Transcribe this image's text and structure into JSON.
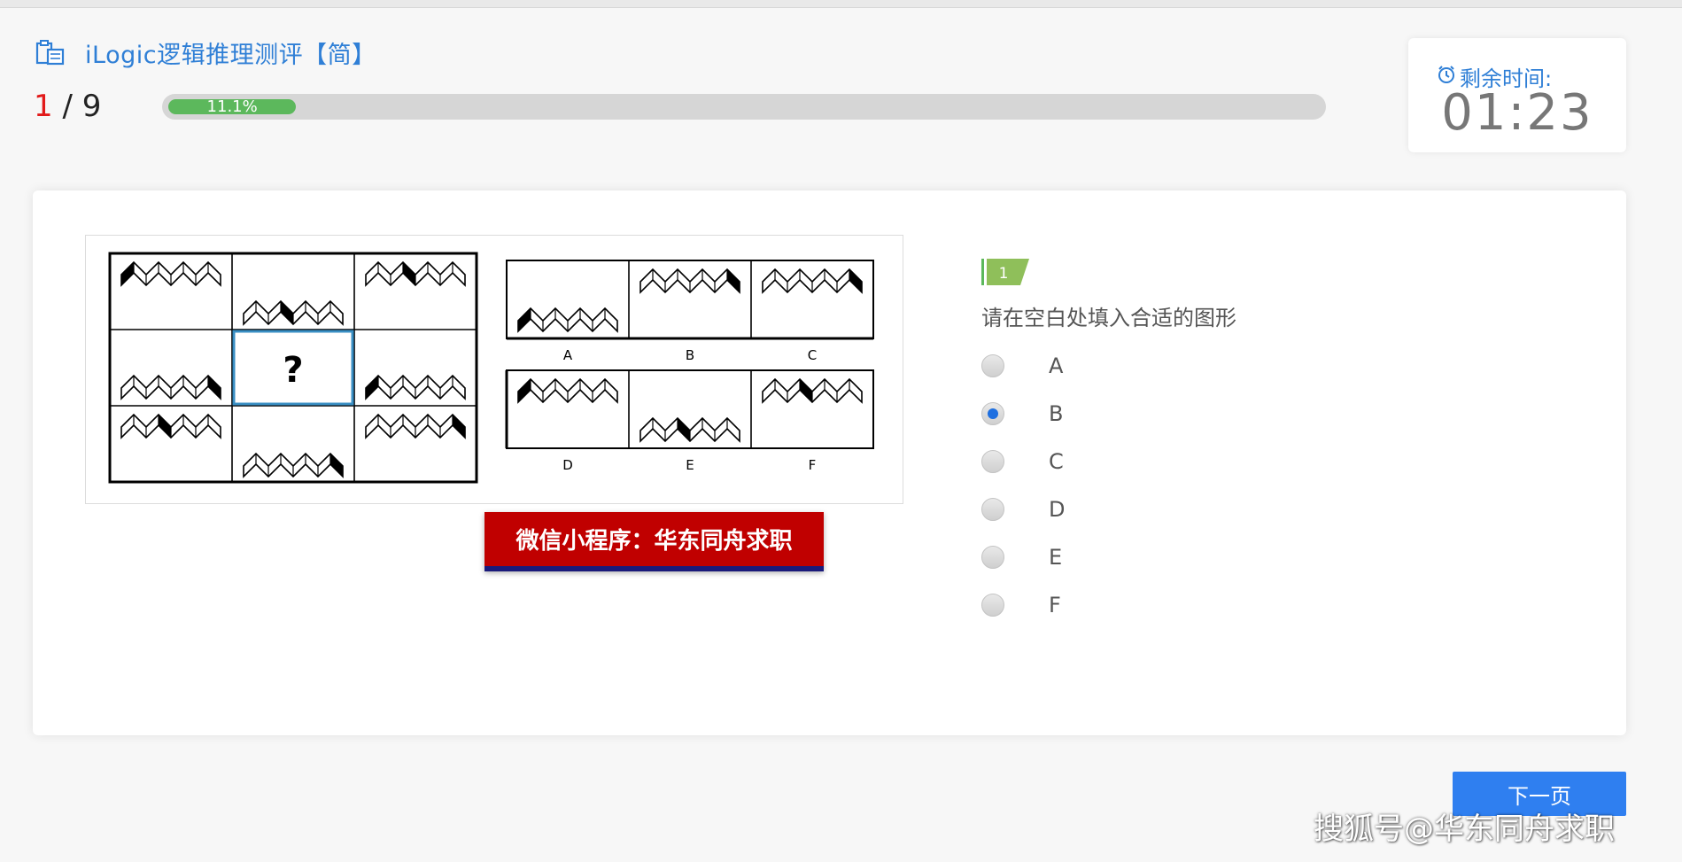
{
  "header": {
    "title": "iLogic逻辑推理测评【简】",
    "icon": "clipboard-icon"
  },
  "progress": {
    "current": "1",
    "separator": " / ",
    "total": "9",
    "percent_text": "11.1%",
    "fraction": 0.111
  },
  "timer": {
    "label": "剩余时间:",
    "value": "01:23",
    "icon": "alarm-clock-icon"
  },
  "question": {
    "number": "1",
    "text": "请在空白处填入合适的图形",
    "puzzle": {
      "question_mark": "?",
      "option_labels": [
        "A",
        "B",
        "C",
        "D",
        "E",
        "F"
      ]
    }
  },
  "options": [
    {
      "label": "A",
      "selected": false
    },
    {
      "label": "B",
      "selected": true
    },
    {
      "label": "C",
      "selected": false
    },
    {
      "label": "D",
      "selected": false
    },
    {
      "label": "E",
      "selected": false
    },
    {
      "label": "F",
      "selected": false
    }
  ],
  "banner": {
    "text": "微信小程序：华东同舟求职"
  },
  "buttons": {
    "next": "下一页"
  },
  "watermark": {
    "text": "搜狐号@华东同舟求职"
  },
  "colors": {
    "accent": "#2f7fd6",
    "progress": "#5cb85c",
    "banner": "#c00000",
    "button": "#2f7ff0",
    "counter_current": "#e21a1a"
  }
}
